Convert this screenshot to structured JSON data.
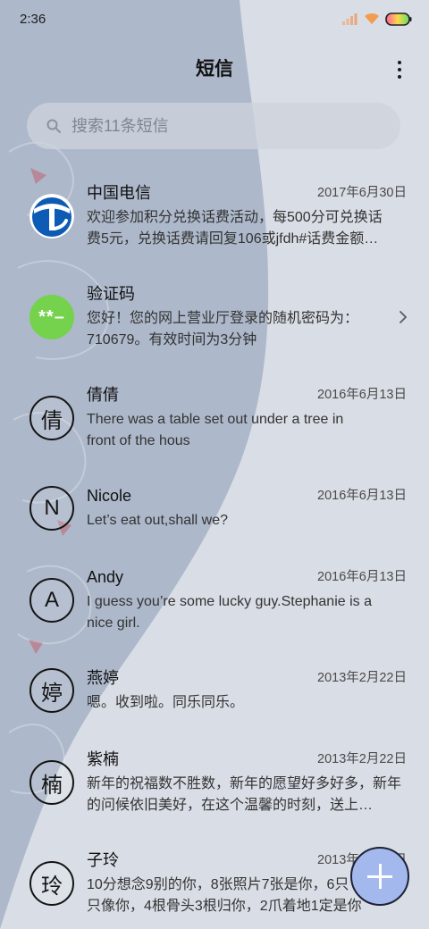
{
  "status_bar": {
    "time": "2:36",
    "icons": [
      "signal-icon",
      "wifi-icon",
      "battery-icon"
    ]
  },
  "header": {
    "title": "短信",
    "menu_icon": "more-vertical-icon"
  },
  "search": {
    "icon": "search-icon",
    "placeholder": "搜索11条短信"
  },
  "conversations": [
    {
      "name": "中国电信",
      "date": "2017年6月30日",
      "preview": [
        "欢迎参加积分兑换话费活动，每500分可兑换话",
        "费5元，兑换话费请回复106或jfdh#话费金额…"
      ],
      "avatar": {
        "icon": "china-telecom-logo-icon"
      }
    },
    {
      "name": "验证码",
      "preview": [
        "您好！您的网上营业厅登录的随机密码为：",
        "710679。有效时间为3分钟"
      ],
      "avatar": {
        "text": "**–",
        "color": "#74d24c"
      },
      "trailing_icon": "chevron-right-icon"
    },
    {
      "name": "倩倩",
      "date": "2016年6月13日",
      "preview": [
        "There was a table set out under a tree in",
        "front of the hous"
      ],
      "avatar": {
        "text": "倩"
      }
    },
    {
      "name": "Nicole",
      "date": "2016年6月13日",
      "preview": [
        "Let’s eat out,shall we?"
      ],
      "avatar": {
        "text": "N"
      }
    },
    {
      "name": "Andy",
      "date": "2016年6月13日",
      "preview": [
        "I guess you’re some lucky guy.Stephanie is a",
        "nice girl."
      ],
      "avatar": {
        "text": "A"
      }
    },
    {
      "name": "燕婷",
      "date": "2013年2月22日",
      "preview": [
        "嗯。收到啦。同乐同乐。"
      ],
      "avatar": {
        "text": "婷"
      }
    },
    {
      "name": "紫楠",
      "date": "2013年2月22日",
      "preview": [
        "新年的祝福数不胜数，新年的愿望好多好多，新年",
        "的问候依旧美好，在这个温馨的时刻，送上…"
      ],
      "avatar": {
        "text": "楠"
      }
    },
    {
      "name": "子玲",
      "date": "2013年2月22日",
      "preview": [
        "10分想念9别的你，8张照片7张是你，6只",
        "只像你，4根骨头3根归你，2爪着地1定是你"
      ],
      "avatar": {
        "text": "玲"
      }
    }
  ],
  "fab": {
    "icon": "plus-icon",
    "color": "#a3b8ec"
  },
  "colors": {
    "wallpaper_dark": "#adb8ca",
    "wallpaper_light": "#d9dde5",
    "telecom_blue": "#0d5bb5"
  }
}
